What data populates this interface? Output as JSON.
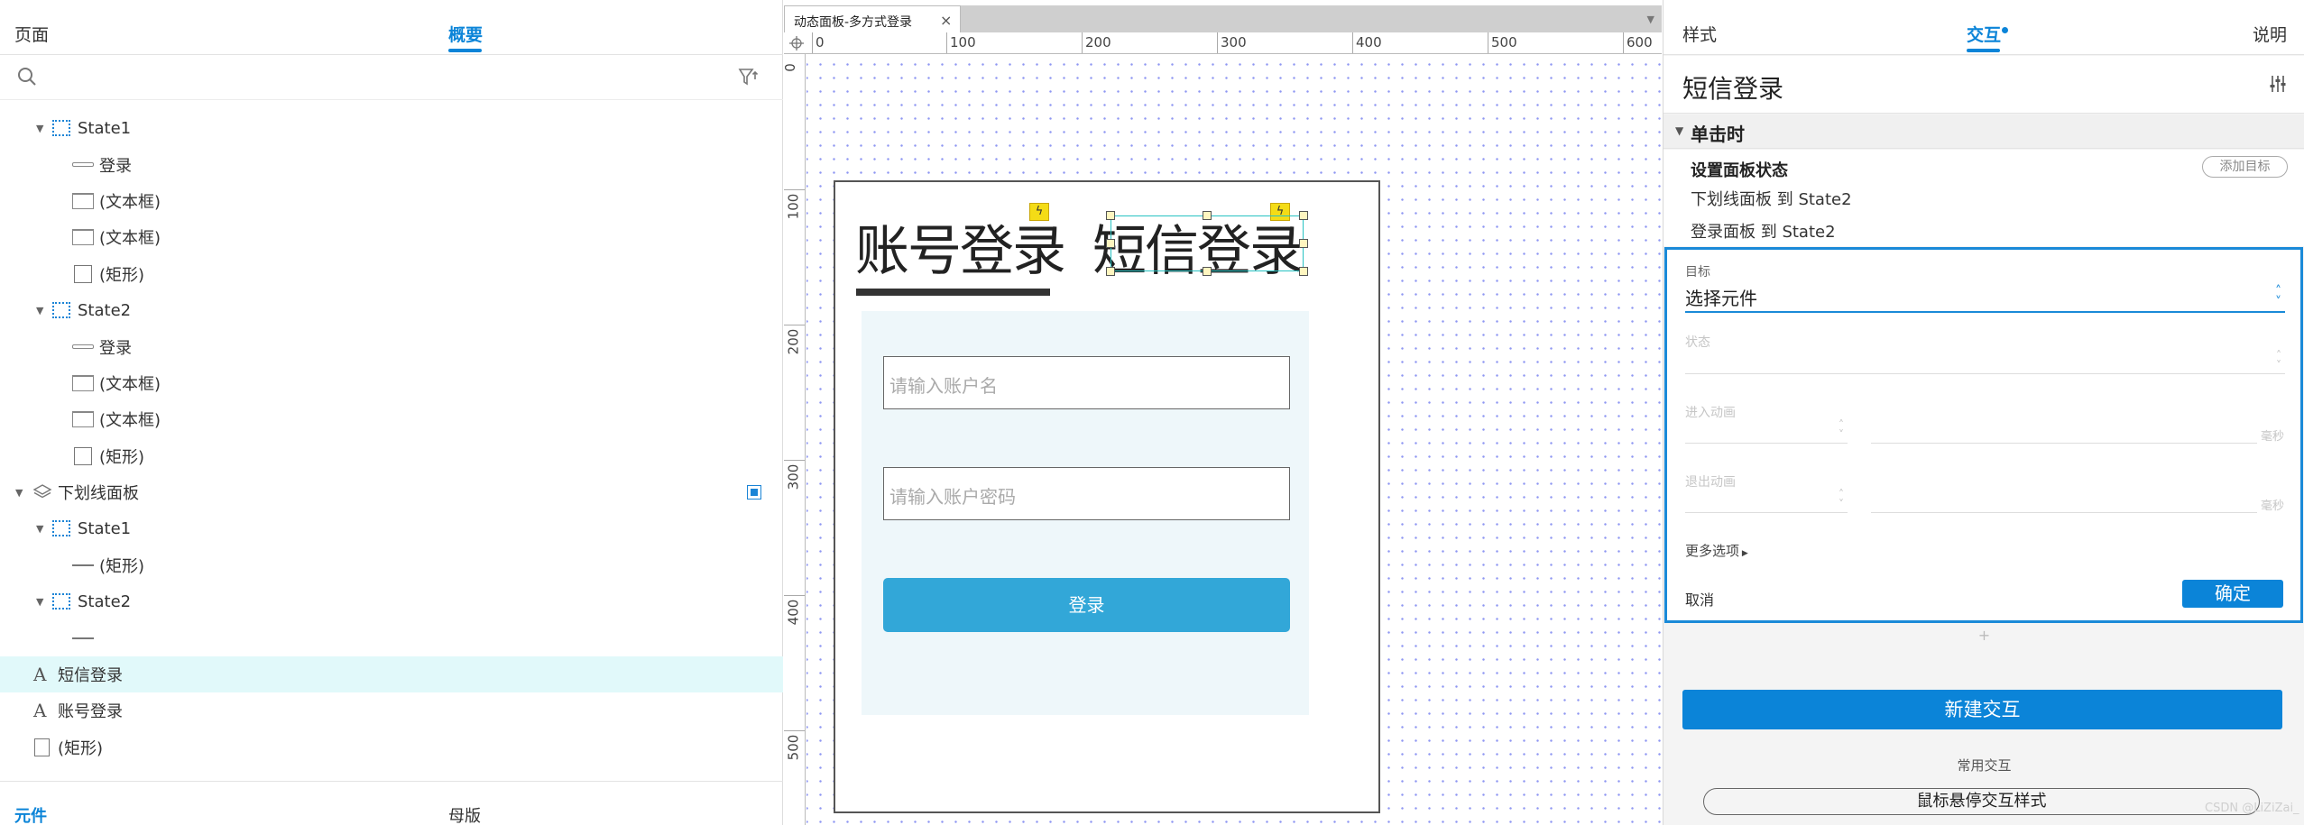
{
  "left_panel": {
    "tabs": [
      "页面",
      "概要"
    ],
    "tree": [
      {
        "label": "State1",
        "icon": "state-icon"
      },
      {
        "label": "登录",
        "icon": "button-icon"
      },
      {
        "label": "(文本框)",
        "icon": "textbox-icon"
      },
      {
        "label": "(文本框)",
        "icon": "textbox-icon"
      },
      {
        "label": "(矩形)",
        "icon": "rect-icon"
      },
      {
        "label": "State2",
        "icon": "state-icon"
      },
      {
        "label": "登录",
        "icon": "button-icon"
      },
      {
        "label": "(文本框)",
        "icon": "textbox-icon"
      },
      {
        "label": "(文本框)",
        "icon": "textbox-icon"
      },
      {
        "label": "(矩形)",
        "icon": "rect-icon"
      },
      {
        "label": "下划线面板",
        "icon": "layers-icon"
      },
      {
        "label": "State1",
        "icon": "state-icon"
      },
      {
        "label": "(矩形)",
        "icon": "line-icon"
      },
      {
        "label": "State2",
        "icon": "state-icon"
      },
      {
        "label": "",
        "icon": "line-icon"
      },
      {
        "label": "短信登录",
        "icon": "text-icon"
      },
      {
        "label": "账号登录",
        "icon": "text-icon"
      },
      {
        "label": "(矩形)",
        "icon": "rect-icon"
      }
    ],
    "bottom_tabs": [
      "元件",
      "母版"
    ]
  },
  "canvas": {
    "tab_title": "动态面板-多方式登录",
    "ruler_x": [
      "0",
      "100",
      "200",
      "300",
      "400",
      "500",
      "600"
    ],
    "ruler_y": [
      "0",
      "100",
      "200",
      "300",
      "400",
      "500"
    ],
    "title_account": "账号登录",
    "title_sms": "短信登录",
    "username_placeholder": "请输入账户名",
    "password_placeholder": "请输入账户密码",
    "login_button": "登录"
  },
  "right_panel": {
    "tabs": [
      "样式",
      "交互",
      "说明"
    ],
    "element_name": "短信登录",
    "event": "单击时",
    "action_title": "设置面板状态",
    "add_target": "添加目标",
    "action_items": [
      "下划线面板 到 State2",
      "登录面板 到 State2"
    ],
    "editor": {
      "target_label": "目标",
      "target_value": "选择元件",
      "state_label": "状态",
      "enter_anim_label": "进入动画",
      "exit_anim_label": "退出动画",
      "ms_unit": "毫秒",
      "more_options": "更多选项",
      "cancel": "取消",
      "ok": "确定"
    },
    "new_interaction": "新建交互",
    "common_label": "常用交互",
    "hover_style": "鼠标悬停交互样式",
    "watermark": "CSDN @LiZiZai_"
  },
  "colors": {
    "accent": "#0b84d8",
    "login_button": "#32a7d8",
    "selection": "#e1f9fa",
    "grid_dot": "#8f97f2"
  }
}
